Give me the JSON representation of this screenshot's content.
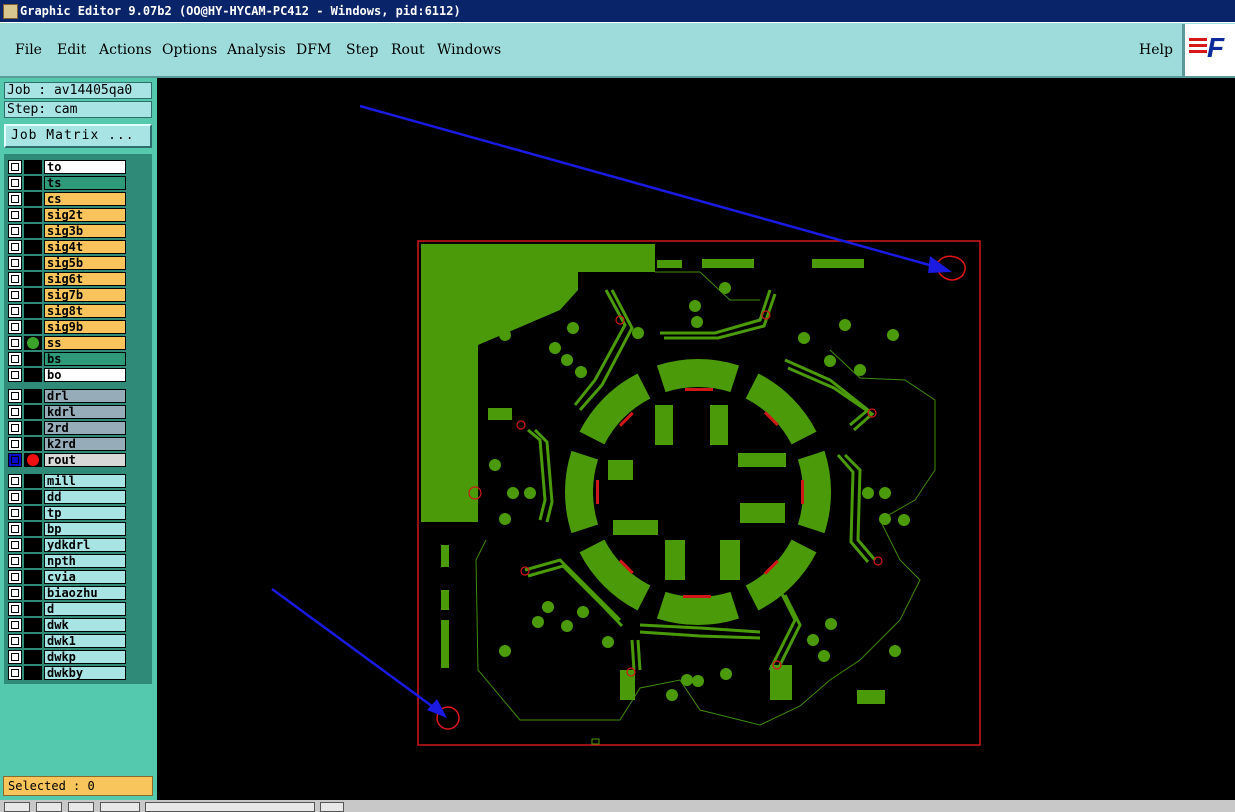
{
  "window": {
    "title": "Graphic Editor 9.07b2 (OO@HY-HYCAM-PC412 - Windows, pid:6112)"
  },
  "menu": {
    "file": "File",
    "edit": "Edit",
    "actions": "Actions",
    "options": "Options",
    "analysis": "Analysis",
    "dfm": "DFM",
    "step": "Step",
    "rout": "Rout",
    "windows": "Windows",
    "help": "Help"
  },
  "logo": {
    "text": "F"
  },
  "job": {
    "label": "Job : av14405qa0",
    "step": "Step: cam",
    "matrix_button": "Job Matrix ..."
  },
  "layers": [
    {
      "name": "to",
      "bg": "#ffffff",
      "dot": ""
    },
    {
      "name": "ts",
      "bg": "#2f9a7a",
      "dot": ""
    },
    {
      "name": "cs",
      "bg": "#f8c45c",
      "dot": ""
    },
    {
      "name": "sig2t",
      "bg": "#f8c45c",
      "dot": ""
    },
    {
      "name": "sig3b",
      "bg": "#f8c45c",
      "dot": ""
    },
    {
      "name": "sig4t",
      "bg": "#f8c45c",
      "dot": ""
    },
    {
      "name": "sig5b",
      "bg": "#f8c45c",
      "dot": ""
    },
    {
      "name": "sig6t",
      "bg": "#f8c45c",
      "dot": ""
    },
    {
      "name": "sig7b",
      "bg": "#f8c45c",
      "dot": ""
    },
    {
      "name": "sig8t",
      "bg": "#f8c45c",
      "dot": ""
    },
    {
      "name": "sig9b",
      "bg": "#f8c45c",
      "dot": ""
    },
    {
      "name": "ss",
      "bg": "#f8c45c",
      "dot": "#3aa52a"
    },
    {
      "name": "bs",
      "bg": "#2f9a7a",
      "dot": ""
    },
    {
      "name": "bo",
      "bg": "#ffffff",
      "dot": ""
    },
    {
      "name": "drl",
      "bg": "#96acb8",
      "dot": ""
    },
    {
      "name": "kdrl",
      "bg": "#96acb8",
      "dot": ""
    },
    {
      "name": "2rd",
      "bg": "#96acb8",
      "dot": ""
    },
    {
      "name": "k2rd",
      "bg": "#96acb8",
      "dot": ""
    },
    {
      "name": "rout",
      "bg": "#d8d8d8",
      "dot": "#ee1111",
      "active": true
    },
    {
      "name": "mill",
      "bg": "#a8e4e4",
      "dot": ""
    },
    {
      "name": "dd",
      "bg": "#a8e4e4",
      "dot": ""
    },
    {
      "name": "tp",
      "bg": "#a8e4e4",
      "dot": ""
    },
    {
      "name": "bp",
      "bg": "#a8e4e4",
      "dot": ""
    },
    {
      "name": "ydkdrl",
      "bg": "#a8e4e4",
      "dot": ""
    },
    {
      "name": "npth",
      "bg": "#a8e4e4",
      "dot": ""
    },
    {
      "name": "cvia",
      "bg": "#a8e4e4",
      "dot": ""
    },
    {
      "name": "biaozhu",
      "bg": "#a8e4e4",
      "dot": ""
    },
    {
      "name": "d",
      "bg": "#a8e4e4",
      "dot": ""
    },
    {
      "name": "dwk",
      "bg": "#a8e4e4",
      "dot": ""
    },
    {
      "name": "dwk1",
      "bg": "#a8e4e4",
      "dot": ""
    },
    {
      "name": "dwkp",
      "bg": "#a8e4e4",
      "dot": ""
    },
    {
      "name": "dwkby",
      "bg": "#a8e4e4",
      "dot": ""
    }
  ],
  "status": {
    "selected": "Selected : 0"
  },
  "colors": {
    "board_green": "#4a9a0a",
    "outline_red": "#d01818",
    "arrow_blue": "#1a1ae0"
  }
}
